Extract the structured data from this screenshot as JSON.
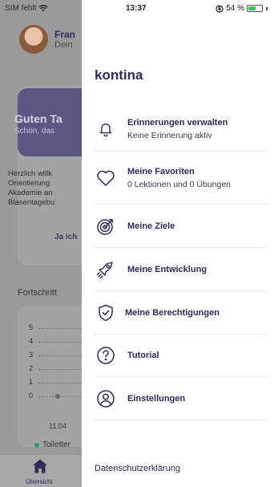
{
  "status": {
    "carrier": "SIM fehlt",
    "time": "13:37",
    "battery": "54 %",
    "battery_level": 0.54
  },
  "background": {
    "profile_name": "Fran",
    "profile_sub": "Dein",
    "card_title": "Guten Ta",
    "card_subtitle": "Schön, das",
    "card_body": [
      "Herzlich willk",
      "Orientierung",
      "Akademie an",
      "Blasentagebu"
    ],
    "card_link": "Ja ich",
    "section_title": "Fortschritt",
    "chart_ticks": [
      "5",
      "4",
      "3",
      "2",
      "1",
      "0"
    ],
    "chart_date": "11.04",
    "legend_label": "Toiletter",
    "tab_label": "Übersicht"
  },
  "drawer": {
    "brand": "kontina",
    "items": [
      {
        "icon": "bell-icon",
        "title": "Erinnerungen verwalten",
        "subtitle": "Keine Erinnerung aktiv"
      },
      {
        "icon": "heart-icon",
        "title": "Meine Favoriten",
        "subtitle": "0 Lektionen und 0 Übungen"
      },
      {
        "icon": "target-icon",
        "title": "Meine Ziele"
      },
      {
        "icon": "rocket-icon",
        "title": "Meine Entwicklung"
      },
      {
        "icon": "shield-check-icon",
        "title": "Meine Berechtigungen"
      },
      {
        "icon": "question-circle-icon",
        "title": "Tutorial"
      },
      {
        "icon": "user-circle-icon",
        "title": "Einstellungen"
      }
    ],
    "footer_link": "Datenschutzerklärung"
  },
  "colors": {
    "brand": "#2e2a5c",
    "overlay": "#9a9a9a",
    "battery_green": "#35c759"
  }
}
